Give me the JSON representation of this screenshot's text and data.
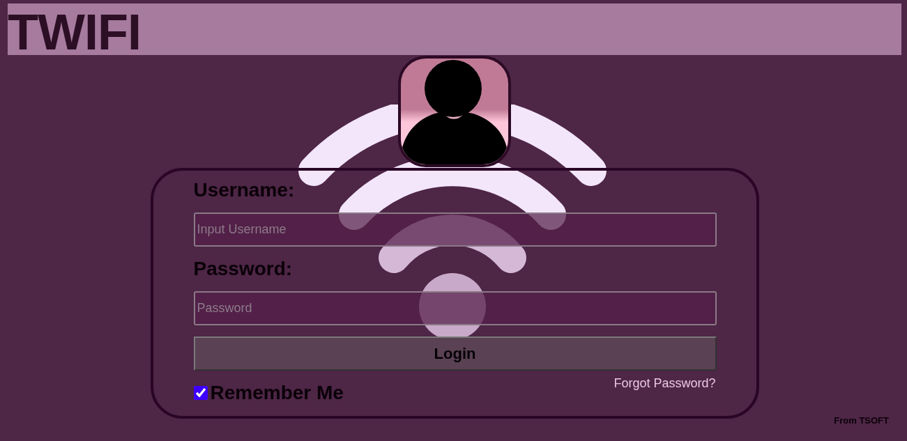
{
  "header": {
    "title": "TWIFI"
  },
  "login": {
    "fields": [
      {
        "label": "Username:",
        "placeholder": "Input Username"
      },
      {
        "label": "Password:",
        "placeholder": "Password"
      }
    ],
    "button": "Login",
    "remember": {
      "label": "Remember Me",
      "checked": true
    },
    "forgot_link": "Forgot Password?"
  },
  "footer": {
    "credit": "From TSOFT"
  }
}
